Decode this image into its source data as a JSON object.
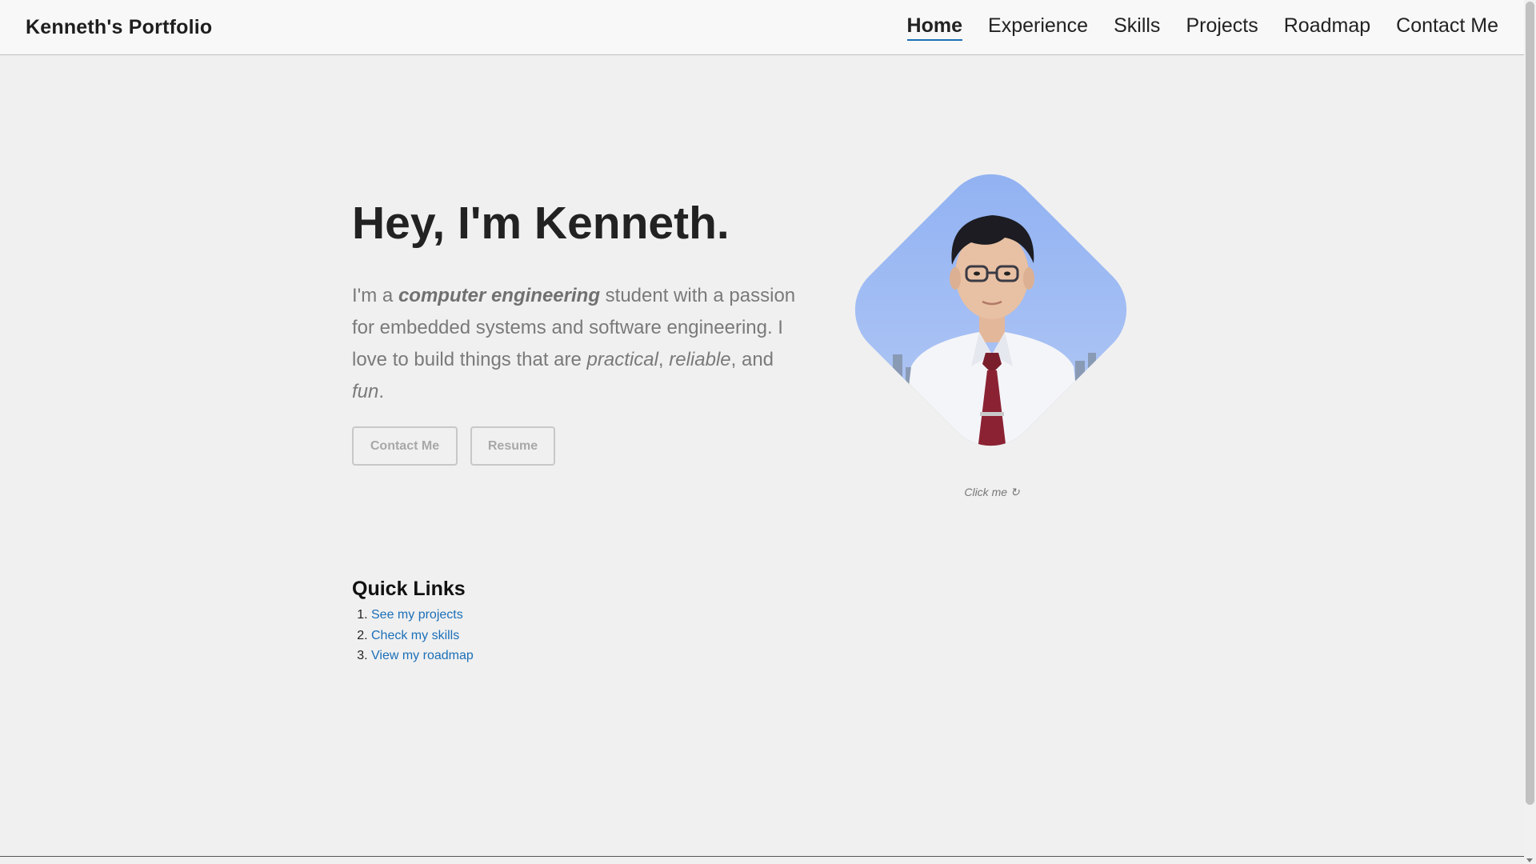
{
  "navbar": {
    "brand": "Kenneth's Portfolio",
    "links": [
      "Home",
      "Experience",
      "Skills",
      "Projects",
      "Roadmap",
      "Contact Me"
    ],
    "active_link": "Home",
    "accent_color": "#1b6fb8"
  },
  "hero": {
    "title": "Hey, I'm Kenneth.",
    "intro_parts": {
      "p1": "I'm a ",
      "strong": "computer engineering",
      "p2": " student with a passion for embedded systems and software engineering. I love to build things that are ",
      "em1": "practical",
      "p3": ", ",
      "em2": "reliable",
      "p4": ", and ",
      "em3": "fun",
      "p5": "."
    },
    "buttons": {
      "contact": "Contact Me",
      "resume": "Resume"
    },
    "photo_hint": "Click me ↻"
  },
  "quick_links": {
    "title": "Quick Links",
    "items": [
      "See my projects",
      "Check my skills",
      "View my roadmap"
    ],
    "link_color": "#1b6fb8"
  }
}
